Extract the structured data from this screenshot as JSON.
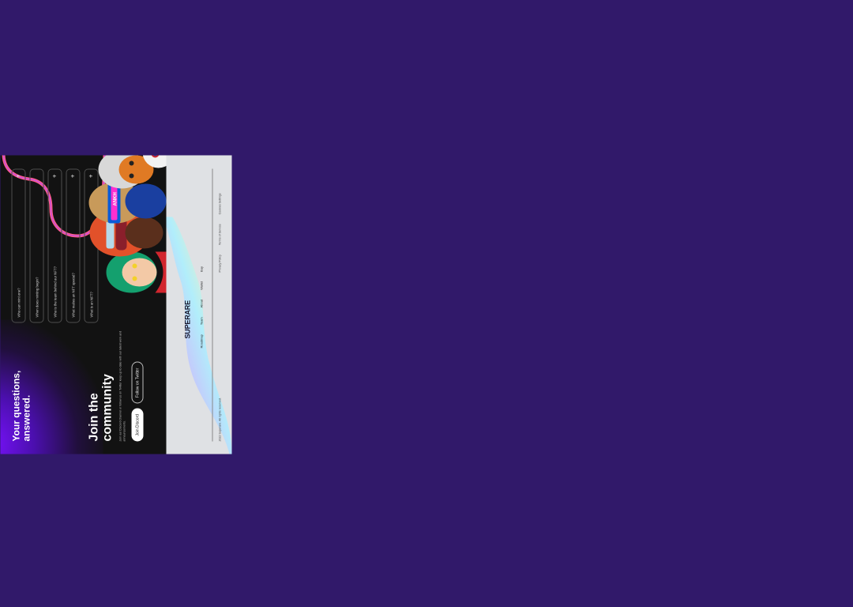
{
  "faq": {
    "title": "Your questions, answered.",
    "items": [
      {
        "question": "Who can mint one?"
      },
      {
        "question": "When does minting begin?"
      },
      {
        "question": "Who is the team behind our NFT?"
      },
      {
        "question": "What makes an NFT special?"
      },
      {
        "question": "What is an NFT?"
      }
    ]
  },
  "community": {
    "title": "Join the community",
    "description": "Join our Discord channel or follow us on Twitter keep up to date with our latest work and announcements.",
    "primary_button": "Join Discord",
    "secondary_button": "Follow on Twitter",
    "hero_caption": "ANKH"
  },
  "footer": {
    "brand": "SUPERARE",
    "nav": [
      "Roadmap",
      "Team",
      "About",
      "Wallet",
      "Buy"
    ],
    "copyright": "2022 Superare. All rights reserved.",
    "legal": [
      "Privacy Policy",
      "Terms of Service",
      "Cookies Settings"
    ]
  },
  "colors": {
    "background": "#31196a",
    "dark_section": "#121212",
    "accent_purple": "#7a12ff",
    "accent_pink": "#ff5c8a",
    "footer_bg": "#dfe1e4"
  }
}
